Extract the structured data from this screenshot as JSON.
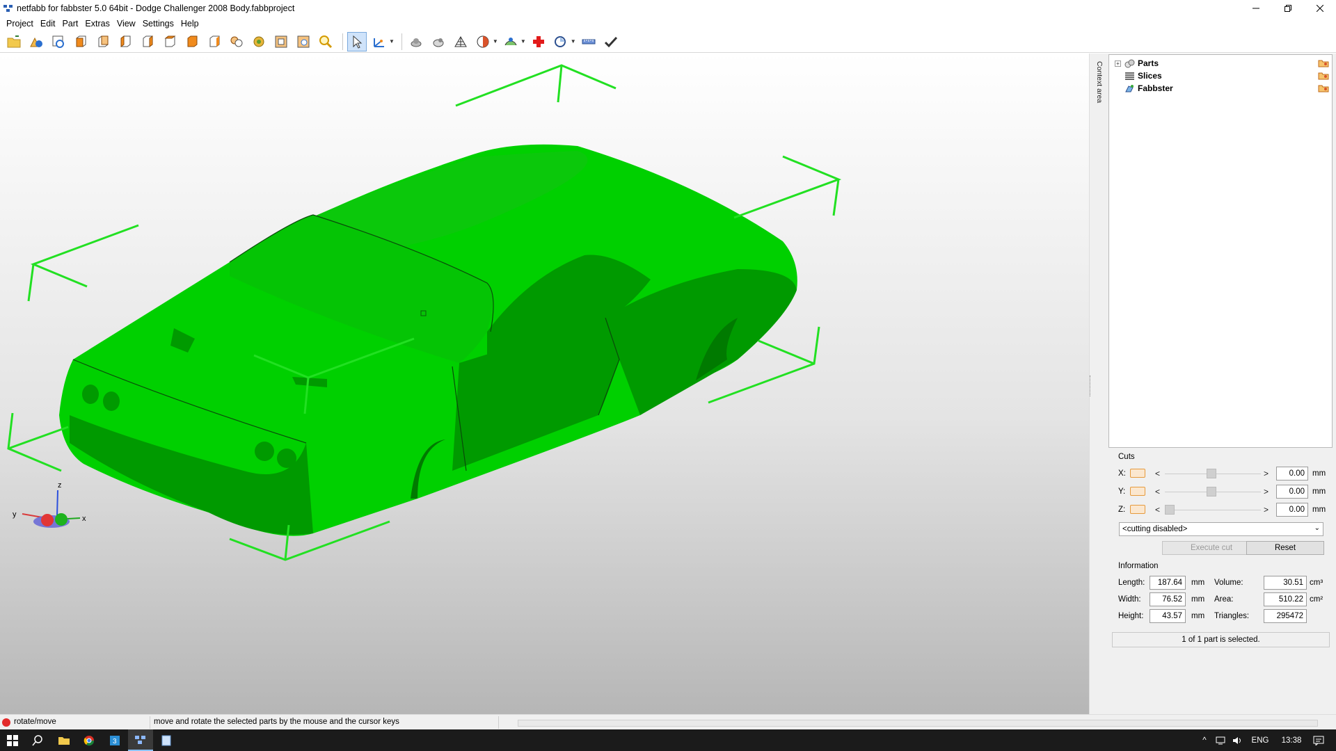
{
  "window": {
    "title": "netfabb for fabbster 5.0 64bit - Dodge Challenger 2008 Body.fabbproject"
  },
  "menu": [
    "Project",
    "Edit",
    "Part",
    "Extras",
    "View",
    "Settings",
    "Help"
  ],
  "toolbar": {
    "buttons": [
      "open-folder-icon",
      "add-part-icon",
      "project-info-icon",
      "view-front-icon",
      "view-back-icon",
      "view-left-icon",
      "view-right-icon",
      "view-top-icon",
      "view-bottom-icon",
      "view-iso-icon",
      "zoom-all-icon",
      "zoom-selected-icon",
      "zoom-box-icon",
      "zoom-area-icon",
      "magnifier-icon",
      "select-arrow-icon",
      "measure-axes-icon",
      "shading-icon",
      "shading-alt-icon",
      "mesh-icon",
      "sectional-icon",
      "repair-view-icon",
      "repair-cross-icon",
      "analysis-icon",
      "ruler-icon",
      "checkmark-icon"
    ]
  },
  "viewport": {
    "model_color": "#00d000",
    "box_color": "#22e022",
    "axes": {
      "x": "x",
      "y": "y",
      "z": "z"
    }
  },
  "sidebar": {
    "context_label": "Context area",
    "tree": [
      {
        "label": "Parts",
        "icon": "parts-icon",
        "expandable": true
      },
      {
        "label": "Slices",
        "icon": "slices-icon",
        "expandable": false
      },
      {
        "label": "Fabbster",
        "icon": "fabbster-icon",
        "expandable": false
      }
    ]
  },
  "cuts": {
    "title": "Cuts",
    "axes": [
      {
        "label": "X:",
        "value": "0.00",
        "unit": "mm",
        "position": 0.5
      },
      {
        "label": "Y:",
        "value": "0.00",
        "unit": "mm",
        "position": 0.5
      },
      {
        "label": "Z:",
        "value": "0.00",
        "unit": "mm",
        "position": 0.0
      }
    ],
    "mode": "<cutting disabled>",
    "execute_label": "Execute cut",
    "reset_label": "Reset"
  },
  "information": {
    "title": "Information",
    "length": {
      "label": "Length:",
      "value": "187.64",
      "unit": "mm"
    },
    "width": {
      "label": "Width:",
      "value": "76.52",
      "unit": "mm"
    },
    "height": {
      "label": "Height:",
      "value": "43.57",
      "unit": "mm"
    },
    "volume": {
      "label": "Volume:",
      "value": "30.51",
      "unit": "cm³"
    },
    "area": {
      "label": "Area:",
      "value": "510.22",
      "unit": "cm²"
    },
    "triangles": {
      "label": "Triangles:",
      "value": "295472"
    },
    "selection_status": "1 of 1 part is selected."
  },
  "statusbar": {
    "mode": "rotate/move",
    "hint": "move and rotate the selected parts by the mouse and the cursor keys"
  },
  "taskbar": {
    "apps": [
      "start-icon",
      "search-icon",
      "file-explorer-icon",
      "chrome-icon",
      "app-3-icon",
      "netfabb-icon",
      "notes-icon"
    ],
    "lang": "ENG",
    "time": "13:38"
  }
}
